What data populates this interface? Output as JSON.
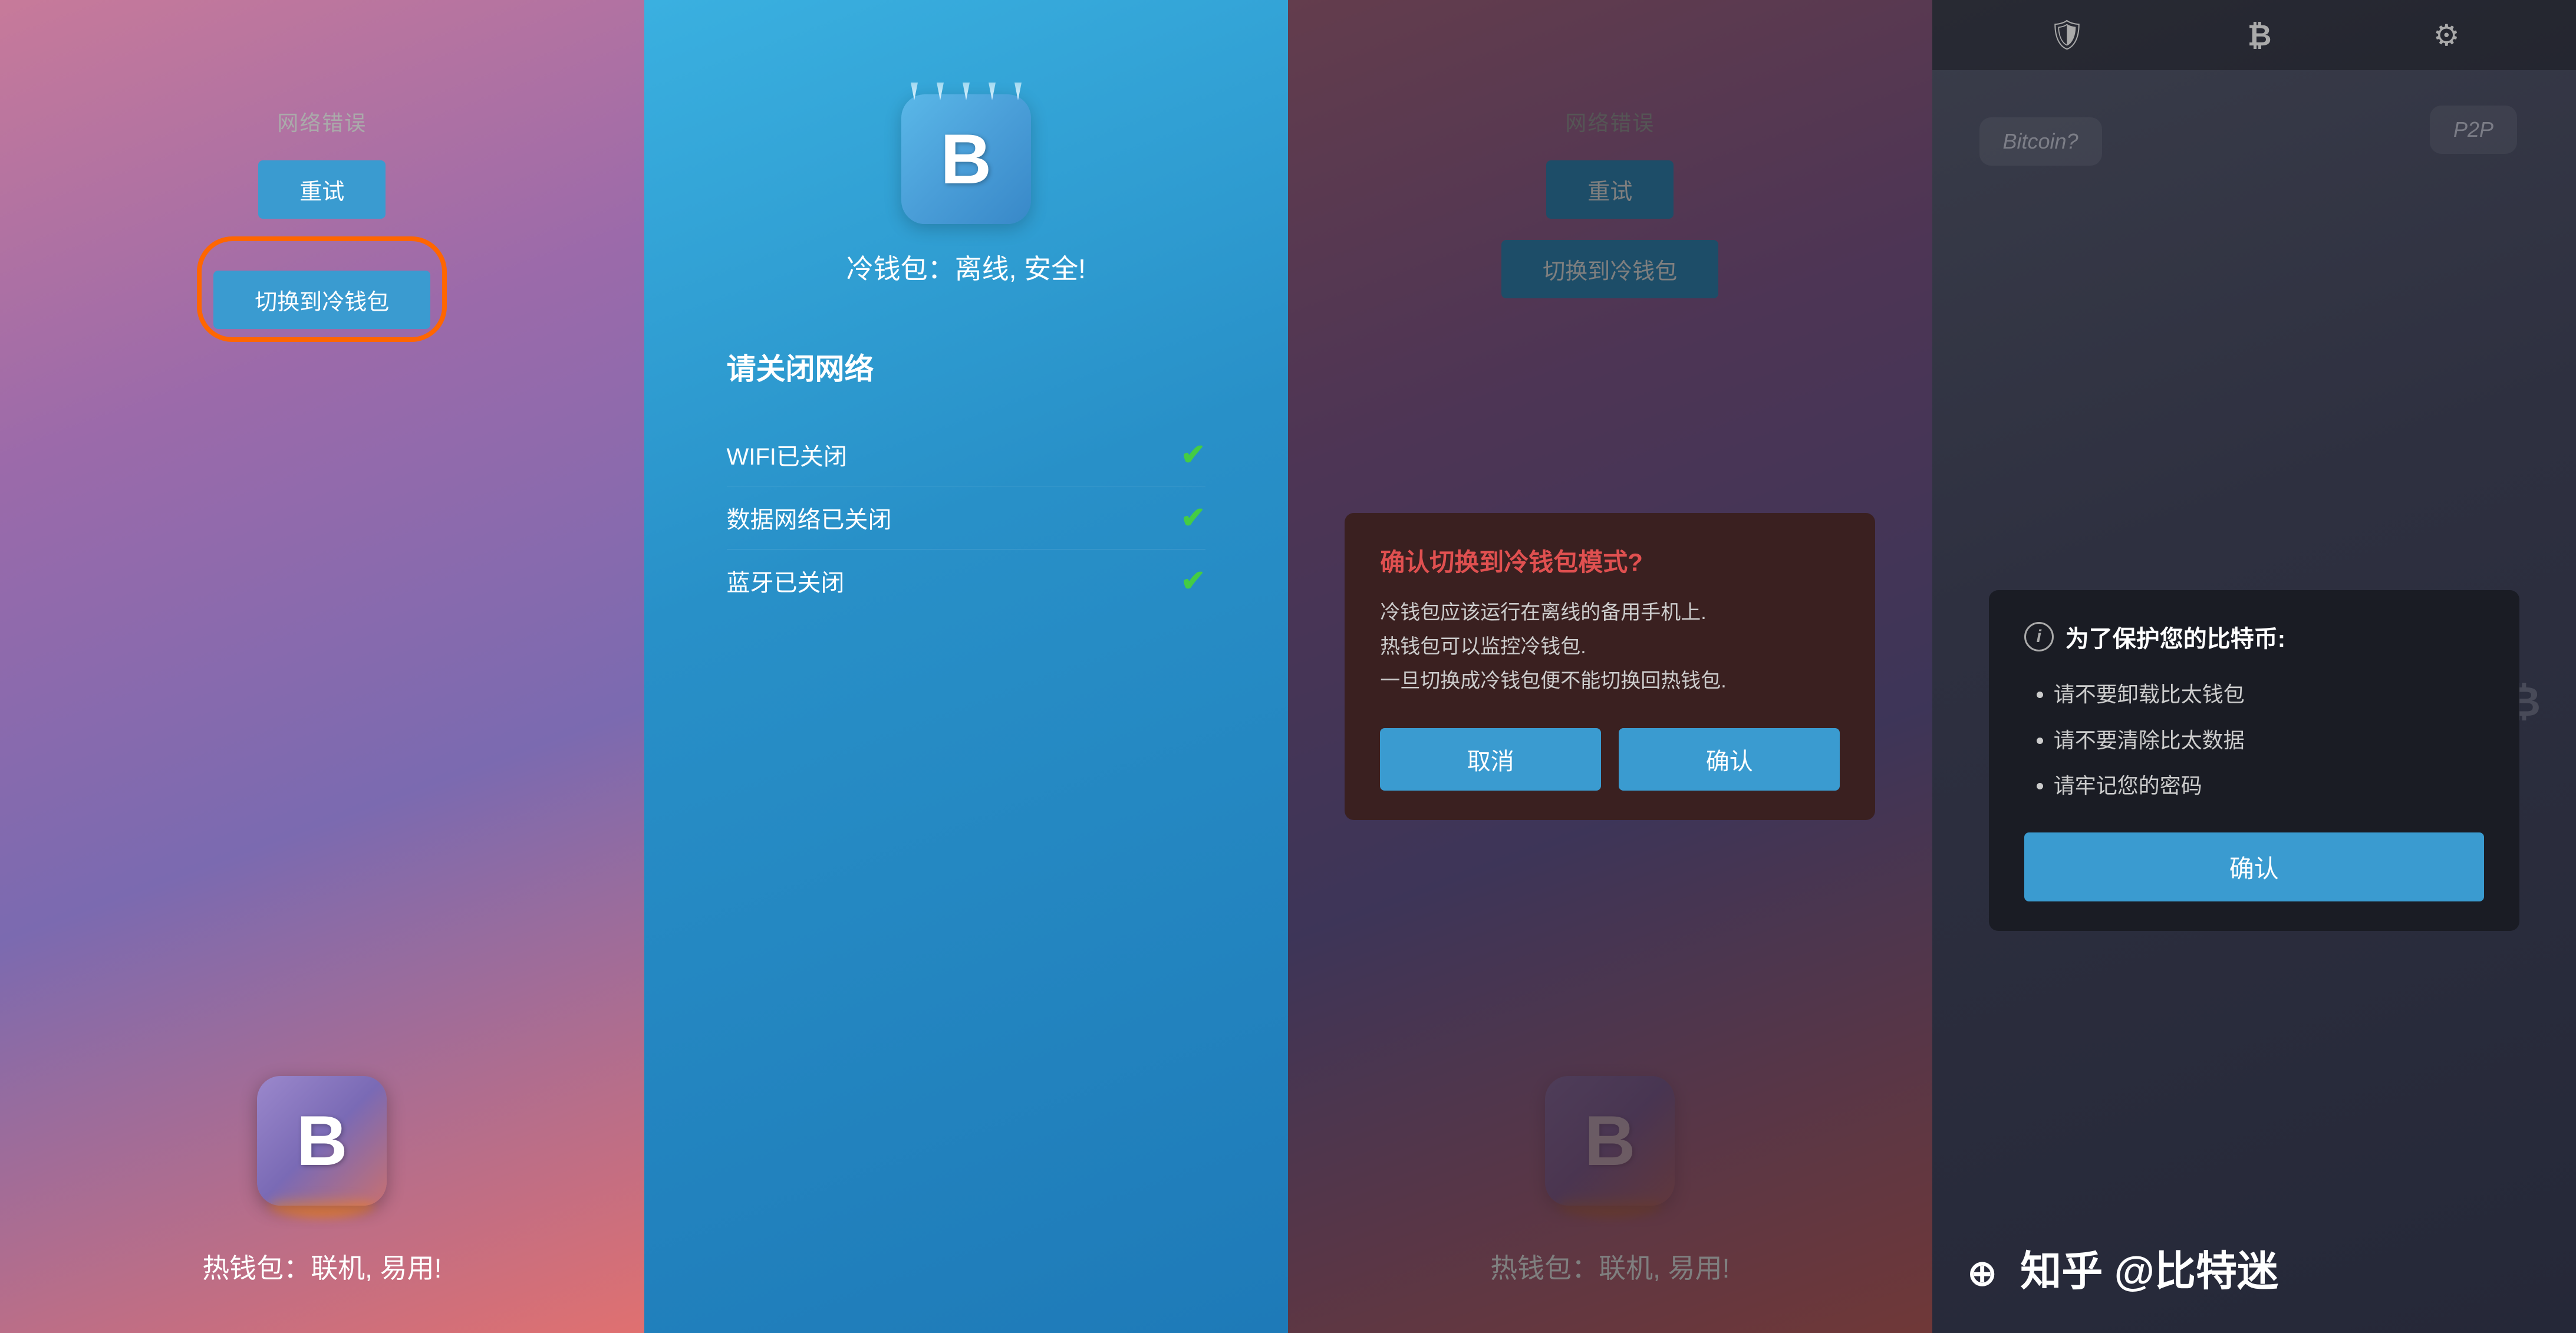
{
  "panel1": {
    "network_error": "网络错误",
    "retry_btn": "重试",
    "switch_btn": "切换到冷钱包",
    "wallet_desc": "热钱包：联机, 易用!",
    "btc_letter": "B"
  },
  "panel2": {
    "cold_title": "冷钱包：离线, 安全!",
    "network_section_title": "请关闭网络",
    "checks": [
      {
        "label": "WIFI已关闭",
        "status": "✔"
      },
      {
        "label": "数据网络已关闭",
        "status": "✔"
      },
      {
        "label": "蓝牙已关闭",
        "status": "✔"
      }
    ],
    "btc_letter": "B"
  },
  "panel3": {
    "network_error": "网络错误",
    "retry_btn": "重试",
    "switch_btn": "切换到冷钱包",
    "wallet_desc": "热钱包：联机, 易用!",
    "btc_letter": "B",
    "dialog": {
      "title": "确认切换到冷钱包模式?",
      "body_line1": "冷钱包应该运行在离线的备用手机上.",
      "body_line2": "热钱包可以监控冷钱包.",
      "body_line3": "一旦切换成冷钱包便不能切换回热钱包.",
      "cancel_btn": "取消",
      "confirm_btn": "确认"
    }
  },
  "panel4": {
    "topbar_shield": "🛡",
    "topbar_bitcoin": "₿",
    "topbar_gear": "⚙",
    "speech_bitcoin": "Bitcoin?",
    "speech_p2p": "P2P",
    "love_btc": "I❤₿",
    "protection_dialog": {
      "info_icon": "i",
      "title": "为了保护您的比特币:",
      "items": [
        "请不要卸载比太钱包",
        "请不要清除比太数据",
        "请牢记您的密码"
      ],
      "confirm_btn": "确认"
    },
    "watermark": "知乎 @比特迷"
  }
}
